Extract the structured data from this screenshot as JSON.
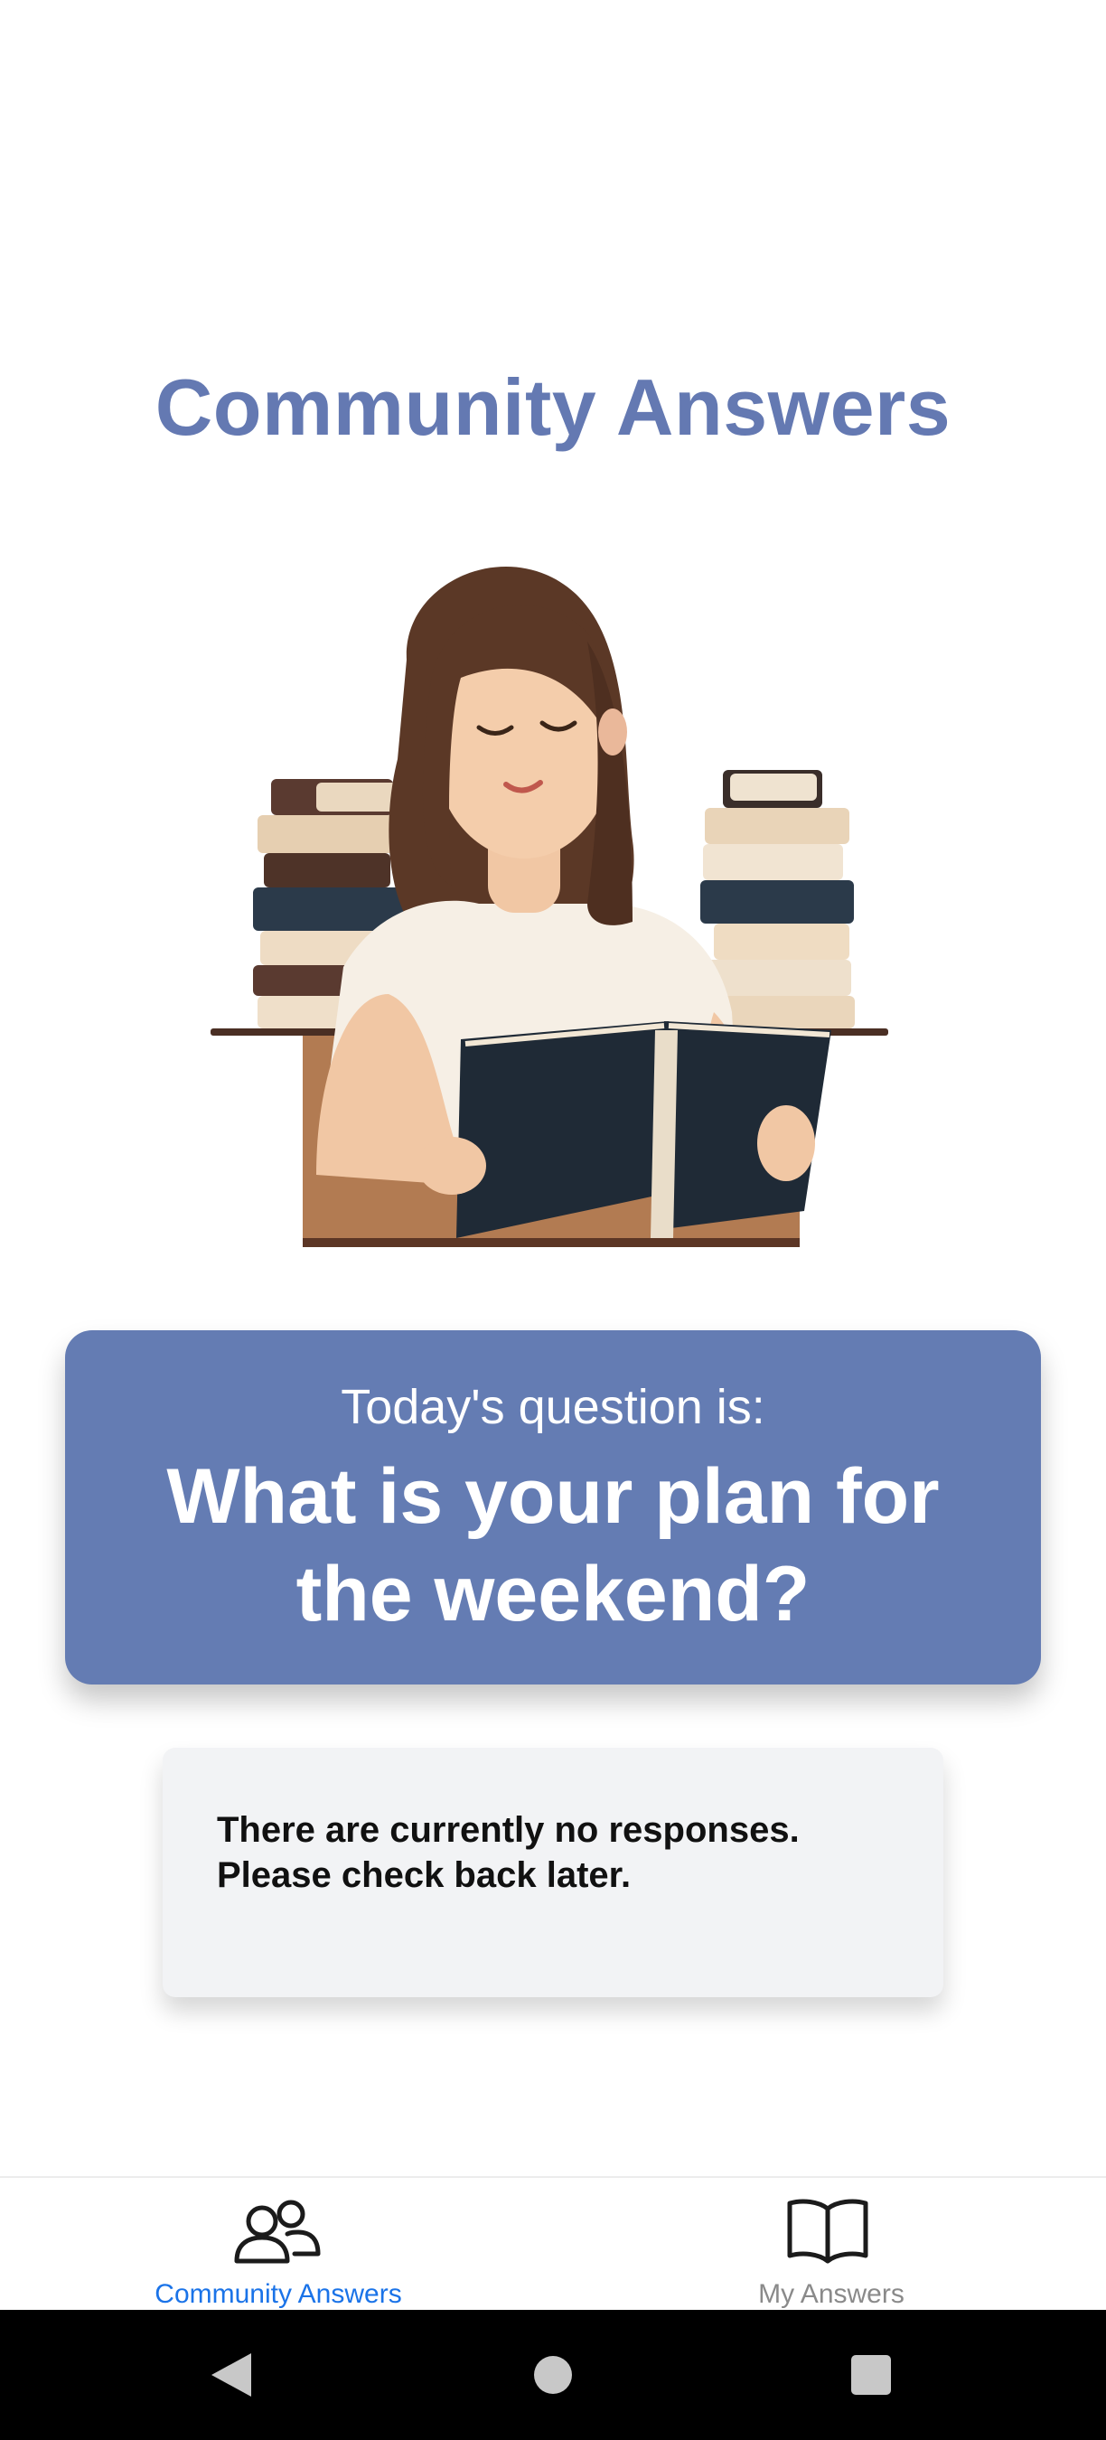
{
  "page": {
    "title": "Community Answers"
  },
  "question": {
    "label": "Today's question is:",
    "text": "What is your plan for the weekend?"
  },
  "responses": {
    "empty_message": "There are currently no responses. Please check back later."
  },
  "bottom_nav": {
    "items": [
      {
        "label": "Community Answers",
        "icon": "people-icon",
        "active": true
      },
      {
        "label": "My Answers",
        "icon": "book-icon",
        "active": false
      }
    ]
  },
  "system_nav": {
    "buttons": [
      "back-icon",
      "home-icon",
      "recents-icon"
    ]
  },
  "colors": {
    "accent": "#6479b2",
    "card": "#647cb3",
    "active_tab": "#1a73e8",
    "inactive_tab": "#8a8a8a"
  }
}
